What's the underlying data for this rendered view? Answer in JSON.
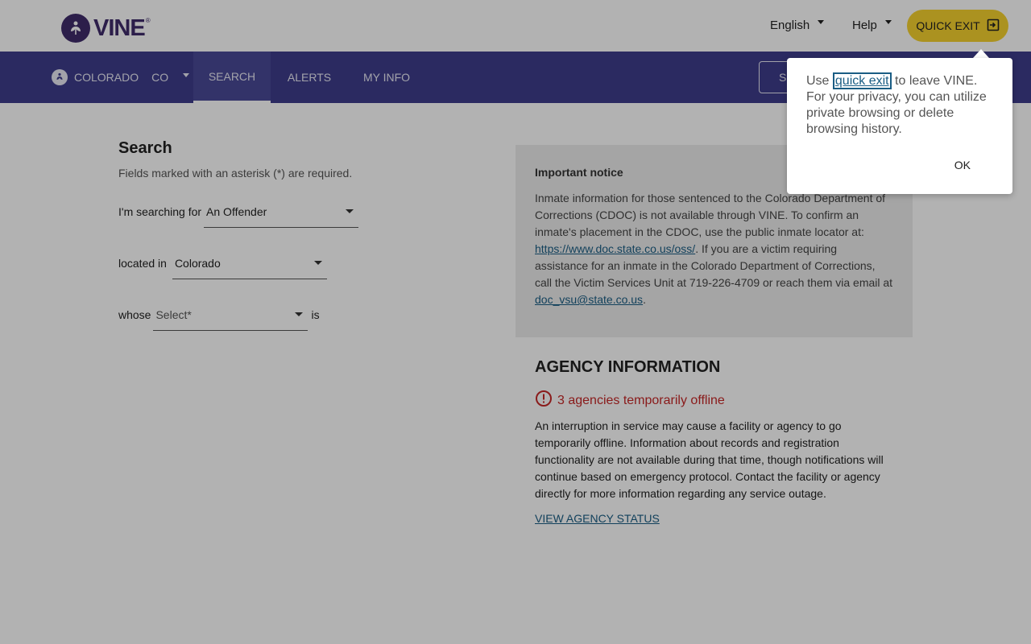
{
  "header": {
    "logo_text": "VINE",
    "logo_reg": "®",
    "language": "English",
    "help": "Help",
    "quick_exit": "QUICK EXIT"
  },
  "nav": {
    "state_name": "COLORADO",
    "state_abbr": "CO",
    "tabs": [
      {
        "label": "SEARCH",
        "active": true
      },
      {
        "label": "ALERTS",
        "active": false
      },
      {
        "label": "MY INFO",
        "active": false
      }
    ],
    "right_button_visible": "S"
  },
  "search": {
    "title": "Search",
    "required_note": "Fields marked with an asterisk (*) are required.",
    "searching_for_label": "I'm searching for",
    "searching_for_value": "An Offender",
    "located_in_label": "located in",
    "located_in_value": "Colorado",
    "whose_label": "whose",
    "whose_placeholder": "Select*",
    "is_label": "is"
  },
  "notice": {
    "title": "Important notice",
    "text_1": "Inmate information for those sentenced to the Colorado Department of Corrections (CDOC) is not available through VINE. To confirm an inmate's placement in the CDOC, use the public inmate locator at: ",
    "link_1": "https://www.doc.state.co.us/oss/",
    "text_2": ". If you are a victim requiring assistance for an inmate in the Colorado Department of Corrections, call the Victim Services Unit at 719-226-4709 or reach them via email at ",
    "link_2": "doc_vsu@state.co.us",
    "text_3": "."
  },
  "agency": {
    "title": "AGENCY INFORMATION",
    "offline": "3 agencies temporarily offline",
    "body": "An interruption in service may cause a facility or agency to go temporarily offline. Information about records and registration functionality are not available during that time, though notifications will continue based on emergency protocol. Contact the facility or agency directly for more information regarding any service outage.",
    "link": "VIEW AGENCY STATUS"
  },
  "popover": {
    "text_before": "Use ",
    "link": "quick exit",
    "text_after": " to leave VINE. For your privacy, you can utilize private browsing or delete browsing history.",
    "ok": "OK"
  },
  "colors": {
    "nav_bg": "#3e3d8c",
    "brand_purple": "#3f2b6b",
    "quick_exit_bg": "#f5d22e",
    "link": "#1a5d84",
    "error": "#c62828"
  }
}
